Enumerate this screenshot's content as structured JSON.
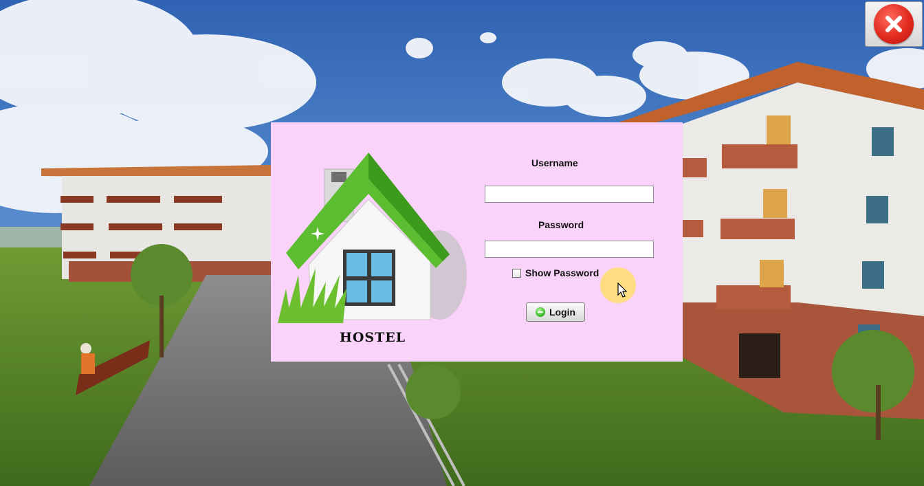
{
  "window": {
    "close_icon": "close-icon",
    "close_color": "#e12a1f"
  },
  "background": {
    "description_icon": "hostel-campus-background"
  },
  "login": {
    "logo_icon": "house-icon",
    "brand_text": "HOSTEL",
    "username_label": "Username",
    "username_value": "",
    "password_label": "Password",
    "password_value": "",
    "show_password_label": "Show Password",
    "show_password_checked": false,
    "login_button_label": "Login",
    "login_icon": "green-circle-icon",
    "panel_color": "#fad3fa"
  },
  "cursor": {
    "icon": "mouse-pointer-icon",
    "highlight_color": "#ffe05a"
  }
}
